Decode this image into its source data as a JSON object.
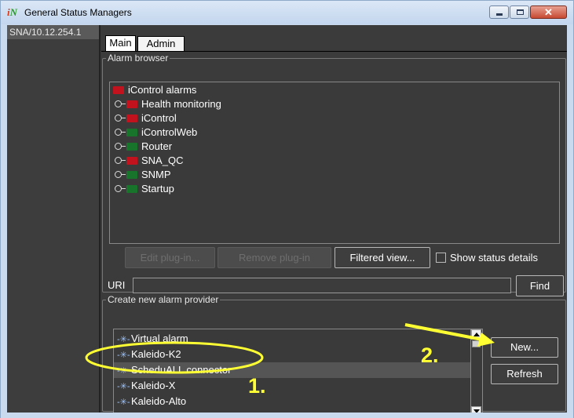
{
  "window": {
    "title": "General Status Managers",
    "app_icon_text": "iN",
    "colors": {
      "frame": "#c9d9ee",
      "panel": "#3b3b3b",
      "annotation": "#ffff33",
      "folder_red": "#c2121e",
      "folder_green": "#17742a"
    }
  },
  "sidebar": {
    "device": "SNA/10.12.254.1"
  },
  "tabs": [
    {
      "label": "Main",
      "selected": true
    },
    {
      "label": "Admin",
      "selected": false
    }
  ],
  "alarm_browser": {
    "legend": "Alarm browser",
    "root": {
      "label": "iControl alarms",
      "icon": "folder-open-icon",
      "color": "red"
    },
    "items": [
      {
        "label": "Health monitoring",
        "folder": "red"
      },
      {
        "label": "iControl",
        "folder": "red"
      },
      {
        "label": "iControlWeb",
        "folder": "green"
      },
      {
        "label": "Router",
        "folder": "green"
      },
      {
        "label": "SNA_QC",
        "folder": "red"
      },
      {
        "label": "SNMP",
        "folder": "green"
      },
      {
        "label": "Startup",
        "folder": "green"
      }
    ],
    "buttons": {
      "edit": "Edit plug-in...",
      "remove": "Remove plug-in",
      "filtered": "Filtered view..."
    },
    "show_status_details": "Show status details",
    "uri_label": "URI",
    "uri_value": "",
    "find": "Find"
  },
  "provider": {
    "legend": "Create new alarm provider",
    "items": [
      {
        "label": "Virtual alarm"
      },
      {
        "label": "Kaleido-K2"
      },
      {
        "label": "ScheduALL connector"
      },
      {
        "label": "Kaleido-X"
      },
      {
        "label": "Kaleido-Alto"
      }
    ],
    "new": "New...",
    "refresh": "Refresh"
  },
  "annotations": {
    "step1": "1.",
    "step2": "2."
  }
}
